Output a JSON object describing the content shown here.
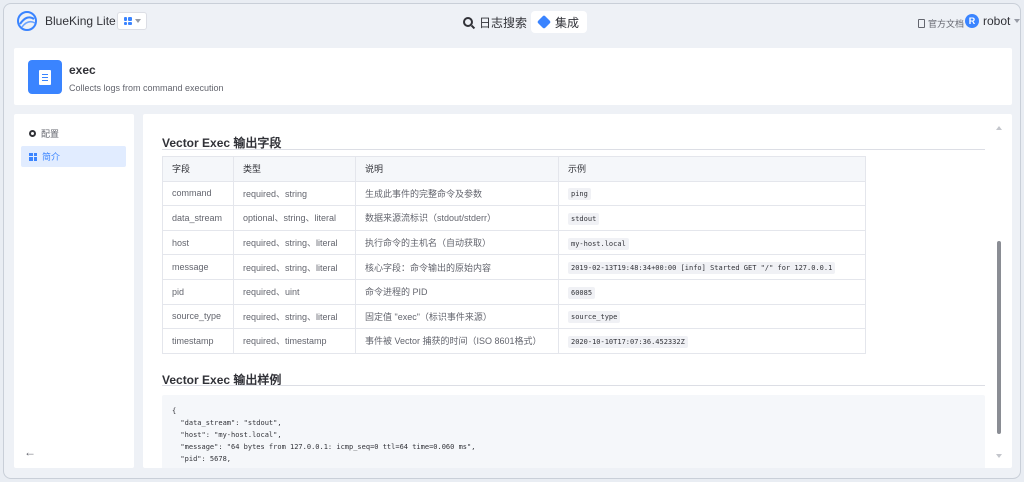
{
  "app": {
    "name": "BlueKing Lite"
  },
  "nav": {
    "tabs": [
      {
        "label": "日志搜索",
        "icon": "search-icon"
      },
      {
        "label": "集成",
        "icon": "cube-icon",
        "active": true
      }
    ],
    "doc_link": "官方文档",
    "user": {
      "avatar_letter": "R",
      "name": "robot"
    }
  },
  "plugin": {
    "title": "exec",
    "description": "Collects logs from command execution"
  },
  "sidebar": {
    "items": [
      {
        "label": "配置",
        "icon": "gear-icon"
      },
      {
        "label": "简介",
        "icon": "grid-icon",
        "active": true
      }
    ]
  },
  "content": {
    "fields_title": "Vector Exec 输出字段",
    "fields_table": {
      "headers": [
        "字段",
        "类型",
        "说明",
        "示例"
      ],
      "rows": [
        [
          "command",
          "required、string",
          "生成此事件的完整命令及参数",
          "ping"
        ],
        [
          "data_stream",
          "optional、string、literal",
          "数据来源流标识（stdout/stderr）",
          "stdout"
        ],
        [
          "host",
          "required、string、literal",
          "执行命令的主机名（自动获取）",
          "my-host.local"
        ],
        [
          "message",
          "required、string、literal",
          "核心字段：命令输出的原始内容",
          "2019-02-13T19:48:34+00:00 [info] Started GET \"/\" for 127.0.0.1"
        ],
        [
          "pid",
          "required、uint",
          "命令进程的 PID",
          "60085"
        ],
        [
          "source_type",
          "required、string、literal",
          "固定值 \"exec\"（标识事件来源）",
          "source_type"
        ],
        [
          "timestamp",
          "required、timestamp",
          "事件被 Vector 捕获的时间（ISO 8601格式）",
          "2020-10-10T17:07:36.452332Z"
        ]
      ]
    },
    "sample_title": "Vector Exec 输出样例",
    "sample_code": "{\n  \"data_stream\": \"stdout\",\n  \"host\": \"my-host.local\",\n  \"message\": \"64 bytes from 127.0.0.1: icmp_seq=0 ttl=64 time=0.060 ms\",\n  \"pid\": 5678,"
  },
  "colors": {
    "accent": "#3a84ff",
    "background": "#eef1f6"
  }
}
